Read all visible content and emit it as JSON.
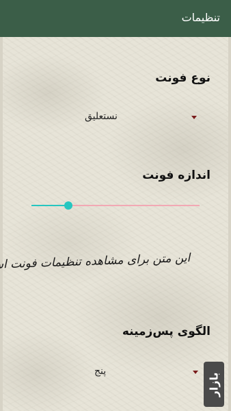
{
  "appbar": {
    "title": "تنظیمات"
  },
  "font_type": {
    "label": "نوع فونت",
    "selected": "نستعلیق"
  },
  "font_size": {
    "label": "اندازه فونت",
    "value_fraction": 0.22,
    "track_color": "#f2a8b4",
    "active_color": "#26c6c0"
  },
  "preview": {
    "text": "این متن برای مشاهده تنظیمات فونت است"
  },
  "background_pattern": {
    "label": "الگوی پس‌زمینه",
    "selected": "پنج"
  },
  "badge": {
    "text": "بازار",
    "icon": "bazaar-logo-icon"
  },
  "colors": {
    "appbar": "#3b5e48",
    "spinner_arrow": "#7a1c1c"
  }
}
